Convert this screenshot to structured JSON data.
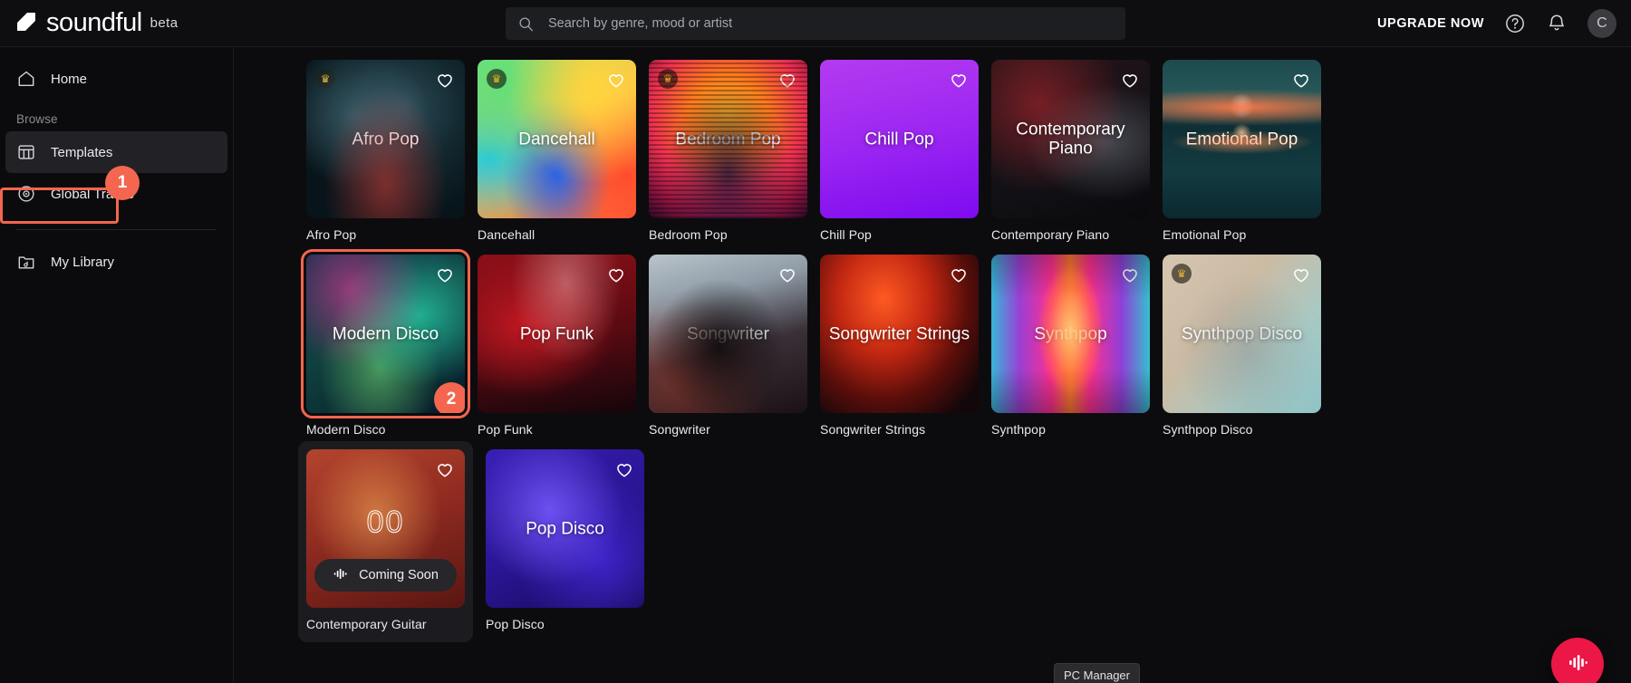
{
  "app": {
    "brand_name": "soundful",
    "brand_tag": "beta"
  },
  "search": {
    "placeholder": "Search by genre, mood or artist",
    "value": "",
    "icon": "search-icon"
  },
  "topbar": {
    "upgrade_label": "UPGRADE NOW",
    "help_icon": "help-circle-icon",
    "notification_icon": "bell-icon",
    "avatar_initial": "C"
  },
  "sidebar": {
    "home_label": "Home",
    "browse_label": "Browse",
    "templates_label": "Templates",
    "global_tracks_label": "Global Tracks",
    "my_library_label": "My Library",
    "icons": {
      "home": "home-icon",
      "templates": "grid-table-icon",
      "global_tracks": "disc-icon",
      "my_library": "folder-music-icon"
    }
  },
  "annotations": {
    "step1": "1",
    "step2": "2",
    "accent_color": "#f4654f"
  },
  "tooltip": {
    "label": "PC Manager"
  },
  "fab": {
    "icon": "waveform-icon",
    "color": "#ec1746"
  },
  "templates": [
    {
      "title": "Afro Pop",
      "label": "Afro Pop",
      "premium": true,
      "bg": "bg-afropop"
    },
    {
      "title": "Dancehall",
      "label": "Dancehall",
      "premium": true,
      "bg": "bg-dancehall"
    },
    {
      "title": "Bedroom Pop",
      "label": "Bedroom Pop",
      "premium": true,
      "bg": "bg-bedroom"
    },
    {
      "title": "Chill Pop",
      "label": "Chill Pop",
      "premium": false,
      "bg": "bg-chillpop"
    },
    {
      "title": "Contemporary Piano",
      "label": "Contemporary Piano",
      "premium": false,
      "bg": "bg-contempiano"
    },
    {
      "title": "Emotional Pop",
      "label": "Emotional Pop",
      "premium": false,
      "bg": "bg-emotional"
    },
    {
      "title": "Modern Disco",
      "label": "Modern Disco",
      "premium": false,
      "bg": "bg-moderndisco",
      "selected": true
    },
    {
      "title": "Pop Funk",
      "label": "Pop Funk",
      "premium": false,
      "bg": "bg-popfunk"
    },
    {
      "title": "Songwriter",
      "label": "Songwriter",
      "premium": false,
      "bg": "bg-songwriter"
    },
    {
      "title": "Songwriter Strings",
      "label": "Songwriter Strings",
      "premium": false,
      "bg": "bg-songstrings"
    },
    {
      "title": "Synthpop",
      "label": "Synthpop",
      "premium": false,
      "bg": "bg-synthpop"
    },
    {
      "title": "Synthpop Disco",
      "label": "Synthpop Disco",
      "premium": true,
      "bg": "bg-synthdisco"
    },
    {
      "title": "",
      "label": "Contemporary Guitar",
      "premium": false,
      "bg": "bg-contempguitar",
      "coming_soon": true,
      "coming_soon_label": "Coming Soon",
      "counter": "00"
    },
    {
      "title": "Pop Disco",
      "label": "Pop Disco",
      "premium": false,
      "bg": "bg-popdisco"
    }
  ]
}
